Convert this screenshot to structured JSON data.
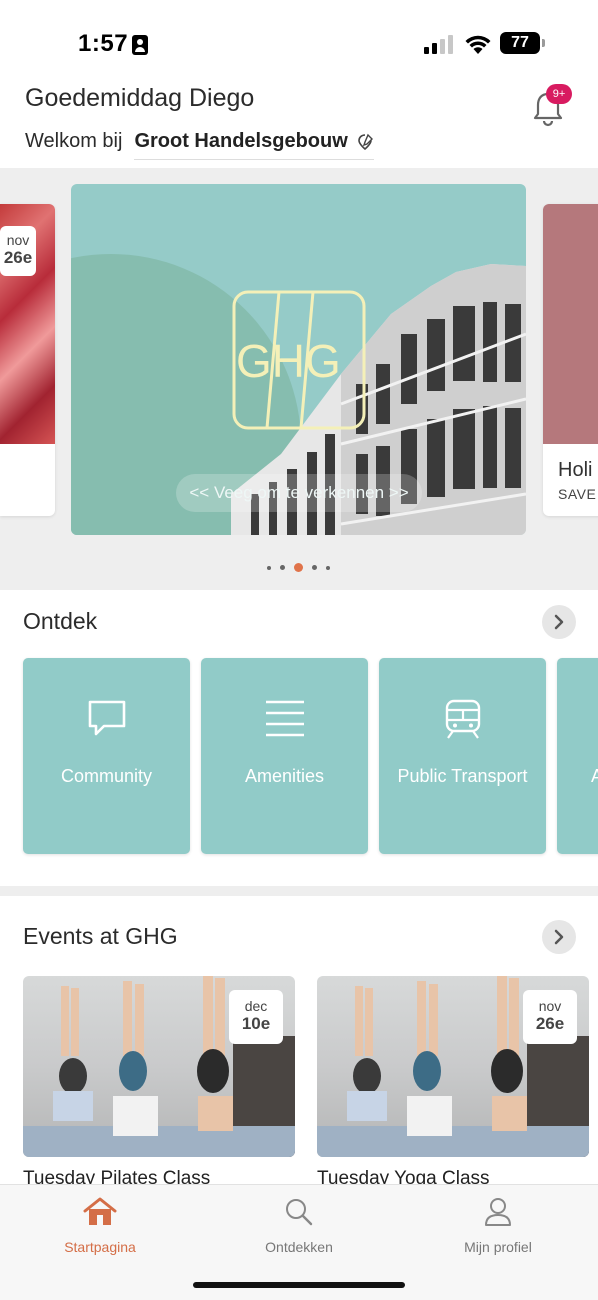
{
  "status_bar": {
    "time": "1:57",
    "battery": "77"
  },
  "header": {
    "greeting": "Goedemiddag Diego",
    "welcome_prefix": "Welkom bij",
    "building_name": "Groot Handelsgebouw",
    "notification_badge": "9+"
  },
  "carousel": {
    "left_card": {
      "month": "nov",
      "day": "26e"
    },
    "hero": {
      "logo_text": "GHG",
      "swipe_hint": "<< Veeg om te verkennen >>"
    },
    "right_card": {
      "title": "Holi",
      "subtitle": "SAVE"
    },
    "active_index": 2,
    "dot_count": 5
  },
  "discover": {
    "title": "Ontdek",
    "tiles": [
      {
        "label": "Community",
        "icon": "chat-bubble-icon"
      },
      {
        "label": "Amenities",
        "icon": "list-icon"
      },
      {
        "label": "Public Transport",
        "icon": "train-icon"
      },
      {
        "label": "A",
        "icon": ""
      }
    ]
  },
  "events": {
    "title": "Events at GHG",
    "items": [
      {
        "month": "dec",
        "day": "10e",
        "title": "Tuesday Pilates Class"
      },
      {
        "month": "nov",
        "day": "26e",
        "title": "Tuesday Yoga Class"
      }
    ]
  },
  "tabbar": {
    "tabs": [
      {
        "label": "Startpagina",
        "icon": "home-icon",
        "active": true
      },
      {
        "label": "Ontdekken",
        "icon": "search-icon",
        "active": false
      },
      {
        "label": "Mijn profiel",
        "icon": "user-icon",
        "active": false
      }
    ]
  },
  "colors": {
    "accent": "#d46e47",
    "teal": "#91cbc8",
    "badge": "#d81b60"
  }
}
